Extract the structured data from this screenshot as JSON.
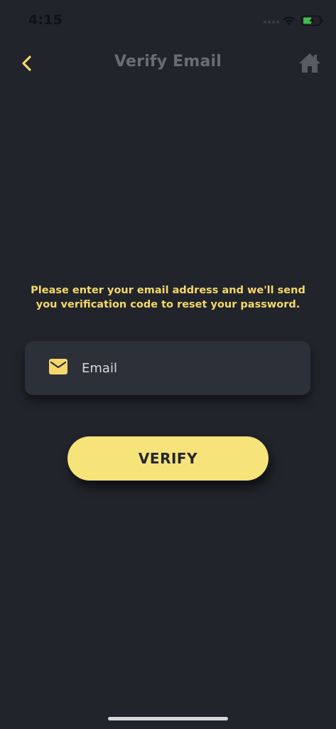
{
  "status_bar": {
    "time": "4:15",
    "battery_icon": "battery-charging-icon",
    "wifi_icon": "wifi-icon"
  },
  "nav": {
    "back_icon": "chevron-left-icon",
    "title": "Verify Email",
    "home_icon": "home-icon"
  },
  "content": {
    "instructions": "Please enter your email address and we'll send you verification code to reset your password.",
    "email_field": {
      "icon": "mail-icon",
      "placeholder": "Email",
      "value": ""
    },
    "verify_label": "VERIFY"
  },
  "colors": {
    "background": "#22242b",
    "accent": "#f5d86b",
    "button": "#f6e37a",
    "field_background": "#2c3038",
    "title": "#6b6d72",
    "battery_charge": "#3dbd4e"
  }
}
